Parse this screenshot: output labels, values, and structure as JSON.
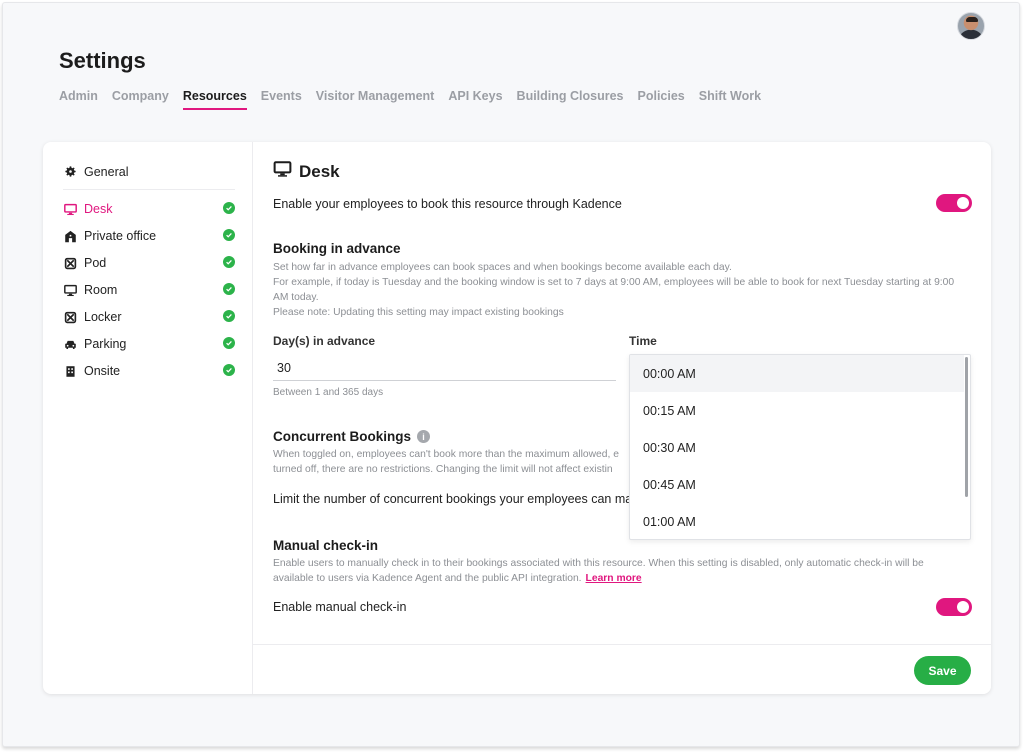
{
  "page": {
    "title": "Settings"
  },
  "tabs": [
    {
      "label": "Admin"
    },
    {
      "label": "Company"
    },
    {
      "label": "Resources",
      "active": true
    },
    {
      "label": "Events"
    },
    {
      "label": "Visitor Management"
    },
    {
      "label": "API Keys"
    },
    {
      "label": "Building Closures"
    },
    {
      "label": "Policies"
    },
    {
      "label": "Shift Work"
    }
  ],
  "sidebar": {
    "general": {
      "label": "General",
      "icon": "gear-icon"
    },
    "items": [
      {
        "label": "Desk",
        "icon": "monitor-icon",
        "active": true
      },
      {
        "label": "Private office",
        "icon": "door-icon"
      },
      {
        "label": "Pod",
        "icon": "pod-icon"
      },
      {
        "label": "Room",
        "icon": "monitor-icon"
      },
      {
        "label": "Locker",
        "icon": "locker-icon"
      },
      {
        "label": "Parking",
        "icon": "car-icon"
      },
      {
        "label": "Onsite",
        "icon": "building-icon"
      }
    ]
  },
  "main": {
    "title": "Desk",
    "enable_text": "Enable your employees to book this resource through Kadence",
    "booking": {
      "title": "Booking in advance",
      "desc1": "Set how far in advance employees can book spaces and when bookings become available each day.",
      "desc2": "For example, if today is Tuesday and the booking window is set to 7 days at 9:00 AM, employees will be able to book for next Tuesday starting at 9:00 AM today.",
      "desc3": "Please note: Updating this setting may impact existing bookings",
      "days_label": "Day(s) in advance",
      "days_value": "30",
      "days_hint": "Between 1 and 365 days",
      "time_label": "Time"
    },
    "concurrent": {
      "title": "Concurrent Bookings",
      "desc": "When toggled on, employees can't book more than the maximum allowed, e",
      "desc2": "turned off, there are no restrictions. Changing the limit will not affect existin",
      "limit_text": "Limit the number of concurrent bookings your employees can ma"
    },
    "checkin": {
      "title": "Manual check-in",
      "desc1": "Enable users to manually check in to their bookings associated with this resource. When this setting is disabled, only automatic check-in will be",
      "desc2": "available to users via Kadence Agent and the public API integration.",
      "learn_more": "Learn more",
      "enable_text": "Enable manual check-in"
    },
    "save_label": "Save"
  },
  "dropdown": {
    "options": [
      "00:00 AM",
      "00:15 AM",
      "00:30 AM",
      "00:45 AM",
      "01:00 AM"
    ],
    "highlighted": "00:00 AM"
  },
  "colors": {
    "accent": "#e0177f",
    "success": "#27ae46"
  }
}
